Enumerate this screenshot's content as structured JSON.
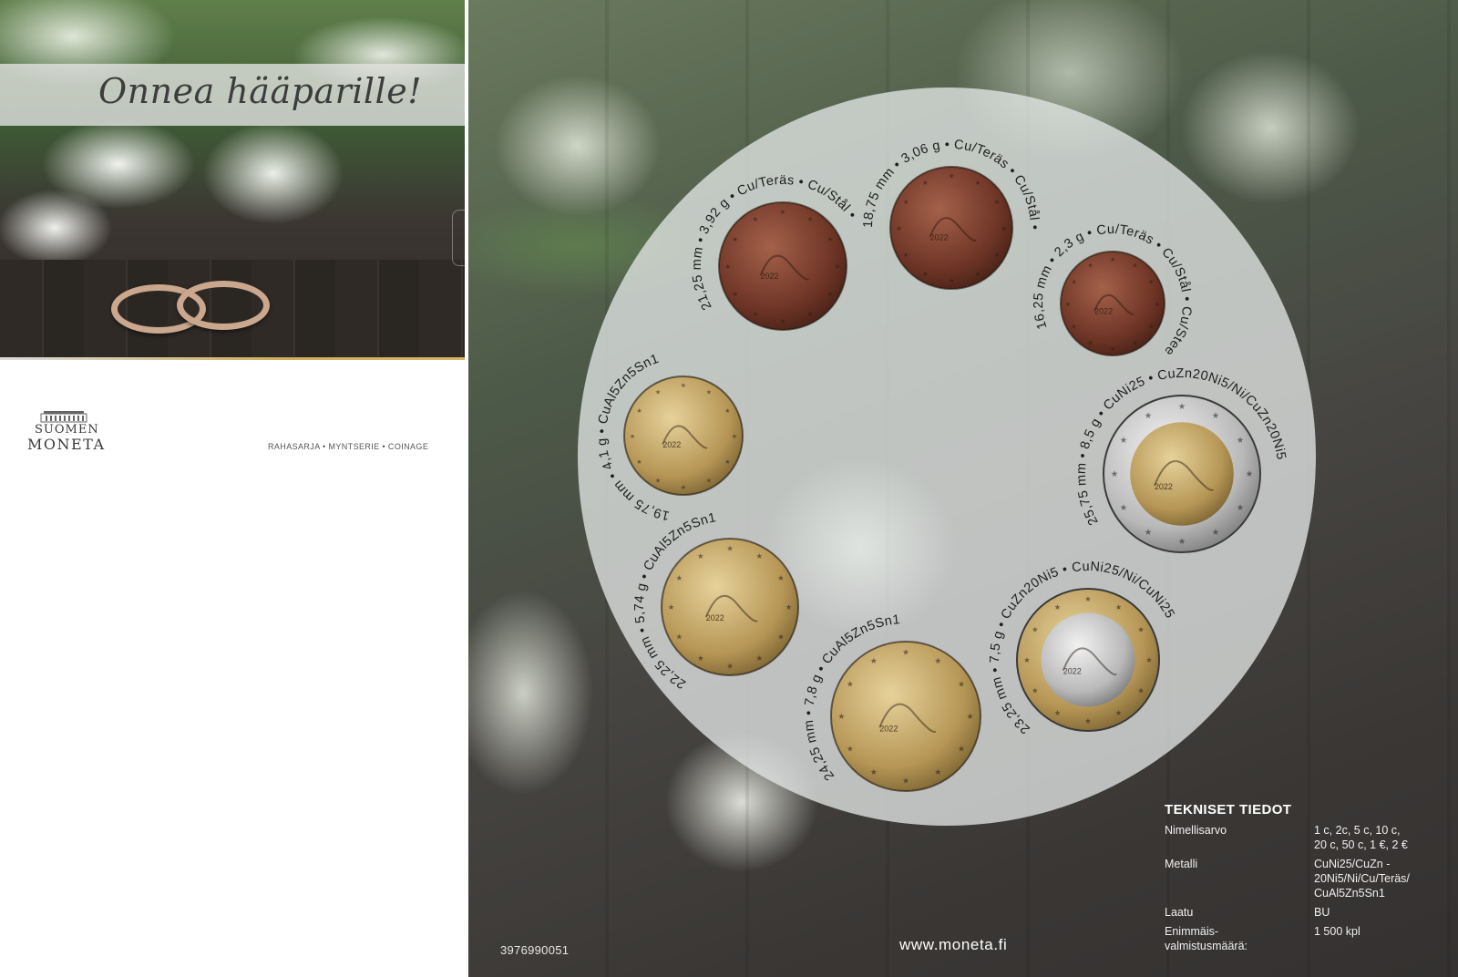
{
  "left_card": {
    "greeting": "Onnea hääparille!",
    "brand_line1": "SUOMEN",
    "brand_line2": "MONETA",
    "series": "RAHASARJA • MYNTSERIE • COINAGE",
    "logo_icon": "building-icon"
  },
  "right_card": {
    "coins": [
      {
        "id": "2-cent",
        "arc_text": "21,25 mm • 3,92 g • Cu/Teräs • Cu/Stål • Cu/Steel",
        "year": "2022",
        "metal": "copper"
      },
      {
        "id": "1-cent",
        "arc_text": "18,75 mm • 3,06 g • Cu/Teräs • Cu/Stål • Cu/Steel",
        "year": "2022",
        "metal": "copper"
      },
      {
        "id": "5-cent",
        "arc_text": "16,25 mm • 2,3 g • Cu/Teräs • Cu/Stål • Cu/Steel",
        "year": "2022",
        "metal": "copper"
      },
      {
        "id": "10-cent",
        "arc_text": "19,75 mm • 4,1 g • CuAl5Zn5Sn1",
        "year": "2022",
        "metal": "nordic-gold"
      },
      {
        "id": "2-euro",
        "arc_text": "25,75 mm • 8,5 g • CuNi25 • CuZn20Ni5/Ni/CuZn20Ni5",
        "year": "2022",
        "metal": "bimetal-silver-ring"
      },
      {
        "id": "20-cent",
        "arc_text": "22,25 mm • 5,74 g • CuAl5Zn5Sn1",
        "year": "2022",
        "metal": "nordic-gold"
      },
      {
        "id": "50-cent",
        "arc_text": "24,25 mm • 7,8 g • CuAl5Zn5Sn1",
        "year": "2022",
        "metal": "nordic-gold"
      },
      {
        "id": "1-euro",
        "arc_text": "23,25 mm • 7,5 g • CuZn20Ni5 • CuNi25/Ni/CuNi25",
        "year": "2022",
        "metal": "bimetal-gold-ring"
      }
    ],
    "tech": {
      "title": "TEKNISET TIEDOT",
      "rows": [
        {
          "label": "Nimellisarvo",
          "value": "1 c, 2c, 5 c, 10 c,\n20 c, 50 c, 1 €, 2 €"
        },
        {
          "label": "Metalli",
          "value": "CuNi25/CuZn -\n20Ni5/Ni/Cu/Teräs/\nCuAl5Zn5Sn1"
        },
        {
          "label": "Laatu",
          "value": "BU"
        },
        {
          "label": "Enimmäis-\nvalmistusmäärä:",
          "value": "1 500 kpl"
        }
      ]
    },
    "website": "www.moneta.fi",
    "product_code": "3976990051"
  },
  "colors": {
    "copper": "#7a3d2a",
    "nordic_gold": "#b79a5c",
    "silver": "#c8c8c8",
    "accent_gold_line": "#cfae5a"
  }
}
